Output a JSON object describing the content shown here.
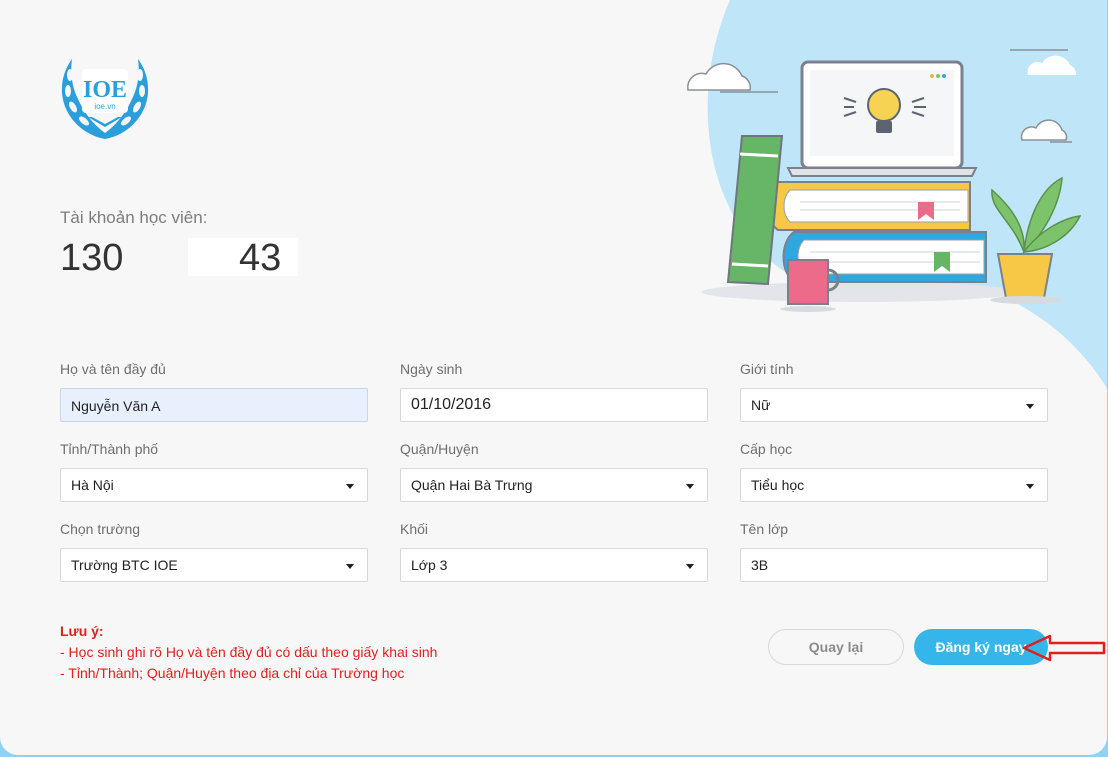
{
  "logo": {
    "brand": "IOE",
    "sub": "ioe.vn"
  },
  "account": {
    "label": "Tài khoản học viên:",
    "prefix": "130",
    "suffix": "43"
  },
  "form": {
    "fullname": {
      "label": "Họ và tên đầy đủ",
      "value": "Nguyễn Văn A"
    },
    "dob": {
      "label": "Ngày sinh",
      "value": "01/10/2016"
    },
    "gender": {
      "label": "Giới tính",
      "value": "Nữ"
    },
    "province": {
      "label": "Tỉnh/Thành phố",
      "value": "Hà Nội"
    },
    "district": {
      "label": "Quận/Huyện",
      "value": "Quận Hai Bà Trưng"
    },
    "level": {
      "label": "Cấp học",
      "value": "Tiểu học"
    },
    "school": {
      "label": "Chọn trường",
      "value": "Trường BTC IOE"
    },
    "grade": {
      "label": "Khối",
      "value": "Lớp 3"
    },
    "classname": {
      "label": "Tên lớp",
      "value": "3B"
    }
  },
  "note": {
    "title": "Lưu ý:",
    "line1": "- Học sinh ghi rõ Họ và tên đầy đủ có dấu theo giấy khai sinh",
    "line2": "- Tỉnh/Thành; Quận/Huyện theo địa chỉ của Trường học"
  },
  "buttons": {
    "back": "Quay lại",
    "register": "Đăng ký ngay"
  },
  "colors": {
    "accent": "#35b6ea",
    "note": "#e0201d",
    "background_blob": "#8ed3f4",
    "card": "#f7f7f7"
  },
  "icons": [
    "ioe-laurel-logo",
    "study-illustration",
    "dropdown-caret-icon",
    "red-arrow-annotation"
  ]
}
